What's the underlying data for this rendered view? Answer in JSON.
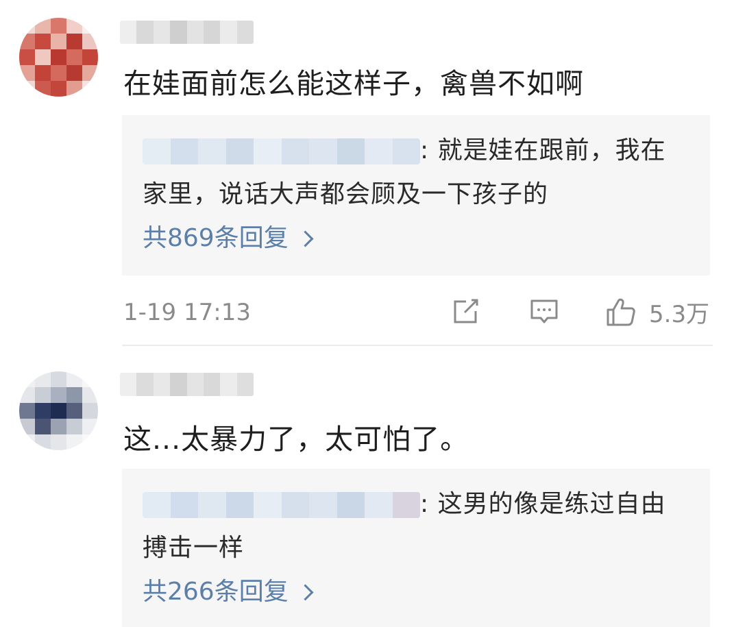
{
  "comments": [
    {
      "text": "在娃面前怎么能这样子，禽兽不如啊",
      "reply": {
        "text_line1": ": 就是娃在跟前，我在",
        "text_line2": "家里，说话大声都会顾及一下孩子的",
        "count_label": "共869条回复"
      },
      "timestamp": "1-19 17:13",
      "likes": "5.3万"
    },
    {
      "text": "这...太暴力了，太可怕了。",
      "reply": {
        "text_line1": ": 这男的像是练过自由",
        "text_line2": "搏击一样",
        "count_label": "共266条回复"
      }
    }
  ],
  "icons": {
    "share": "share-icon",
    "reply": "comment-icon",
    "like": "thumbs-up-icon",
    "expand": "chevron-right-icon"
  },
  "colors": {
    "link": "#5b7fa9",
    "meta": "#8a8a8a",
    "reply_bg": "#f6f6f7"
  }
}
